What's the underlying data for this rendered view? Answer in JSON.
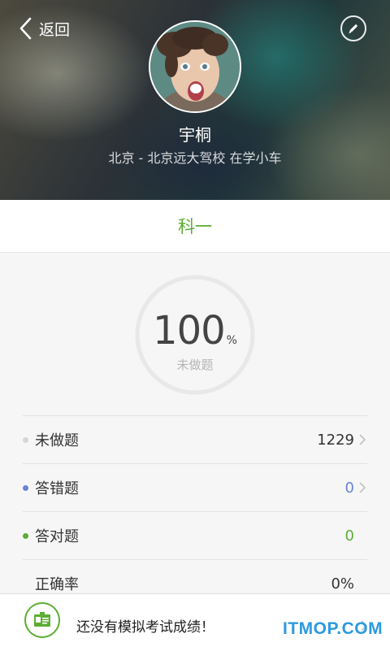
{
  "header": {
    "back_label": "返回",
    "username": "宇桐",
    "userinfo": "北京 - 北京远大驾校 在学小车"
  },
  "subject_tab": "科一",
  "progress": {
    "value": "100",
    "unit": "%",
    "label": "未做题",
    "fraction": 1.0
  },
  "stats": [
    {
      "label": "未做题",
      "value": "1229",
      "dot_color": "#d6d6d6",
      "value_color": "#333333"
    },
    {
      "label": "答错题",
      "value": "0",
      "dot_color": "#6a82d8",
      "value_color": "#6a82d8"
    },
    {
      "label": "答对题",
      "value": "0",
      "dot_color": "#5cad33",
      "value_color": "#5cad33"
    },
    {
      "label": "正确率",
      "value": "0%",
      "dot_color": "",
      "value_color": "#333333"
    }
  ],
  "bottom": {
    "text": "还没有模拟考试成绩！",
    "watermark": "ITMOP.COM"
  },
  "colors": {
    "accent": "#5cad33",
    "wrong": "#6a82d8",
    "ring": "#e8e8e8"
  }
}
